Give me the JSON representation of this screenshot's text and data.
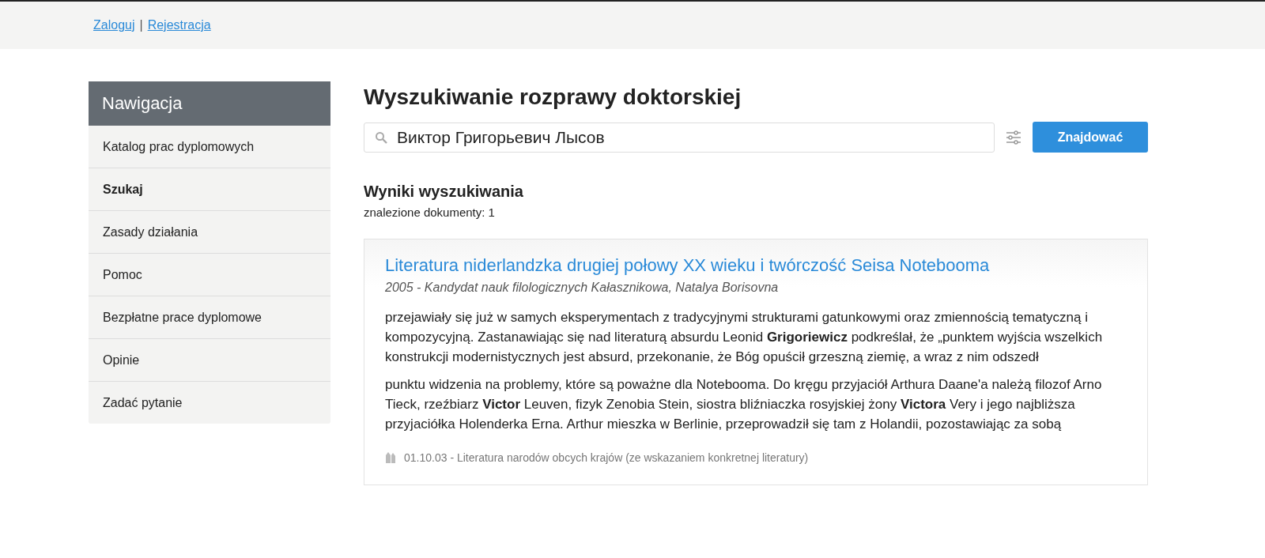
{
  "top_bar": {
    "links": [
      "Zaloguj",
      "Rejestracja"
    ],
    "separator": "|"
  },
  "sidebar": {
    "title": "Nawigacja",
    "items": [
      {
        "label": "Katalog prac dyplomowych",
        "selected": false
      },
      {
        "label": "Szukaj",
        "selected": true
      },
      {
        "label": "Zasady działania",
        "selected": false
      },
      {
        "label": "Pomoc",
        "selected": false
      },
      {
        "label": "Bezpłatne prace dyplomowe",
        "selected": false
      },
      {
        "label": "Opinie",
        "selected": false
      },
      {
        "label": "Zadać pytanie",
        "selected": false
      }
    ]
  },
  "main": {
    "title": "Wyszukiwanie rozprawy doktorskiej",
    "search": {
      "value": "Виктор Григорьевич Лысов",
      "button": "Znajdować"
    },
    "results_title": "Wyniki wyszukiwania",
    "results_count": "znalezione dokumenty: 1",
    "results": [
      {
        "title": "Literatura niderlandzka drugiej połowy XX wieku i twórczość Seisa Notebooma",
        "meta": "2005 - Kandydat nauk filologicznych Kałasznikowa, Natalya Borisovna",
        "snippets": [
          "przejawiały się już w samych eksperymentach z tradycyjnymi strukturami gatunkowymi oraz zmiennością tematyczną i kompozycyjną. Zastanawiając się nad literaturą absurdu Leonid **Grigoriewicz** podkreślał, że „punktem wyjścia wszelkich konstrukcji modernistycznych jest absurd, przekonanie, że Bóg opuścił grzeszną ziemię, a wraz z nim odszedł",
          "punktu widzenia na problemy, które są poważne dla Notebooma. Do kręgu przyjaciół Arthura Daane'a należą filozof Arno Tieck, rzeźbiarz **Victor** Leuven, fizyk Zenobia Stein, siostra bliźniaczka rosyjskiej żony **Victora** Very i jego najbliższa przyjaciółka Holenderka Erna. Arthur mieszka w Berlinie, przeprowadził się tam z Holandii, pozostawiając za sobą"
        ],
        "category": "01.10.03 - Literatura narodów obcych krajów (ze wskazaniem konkretnej literatury)"
      }
    ]
  }
}
